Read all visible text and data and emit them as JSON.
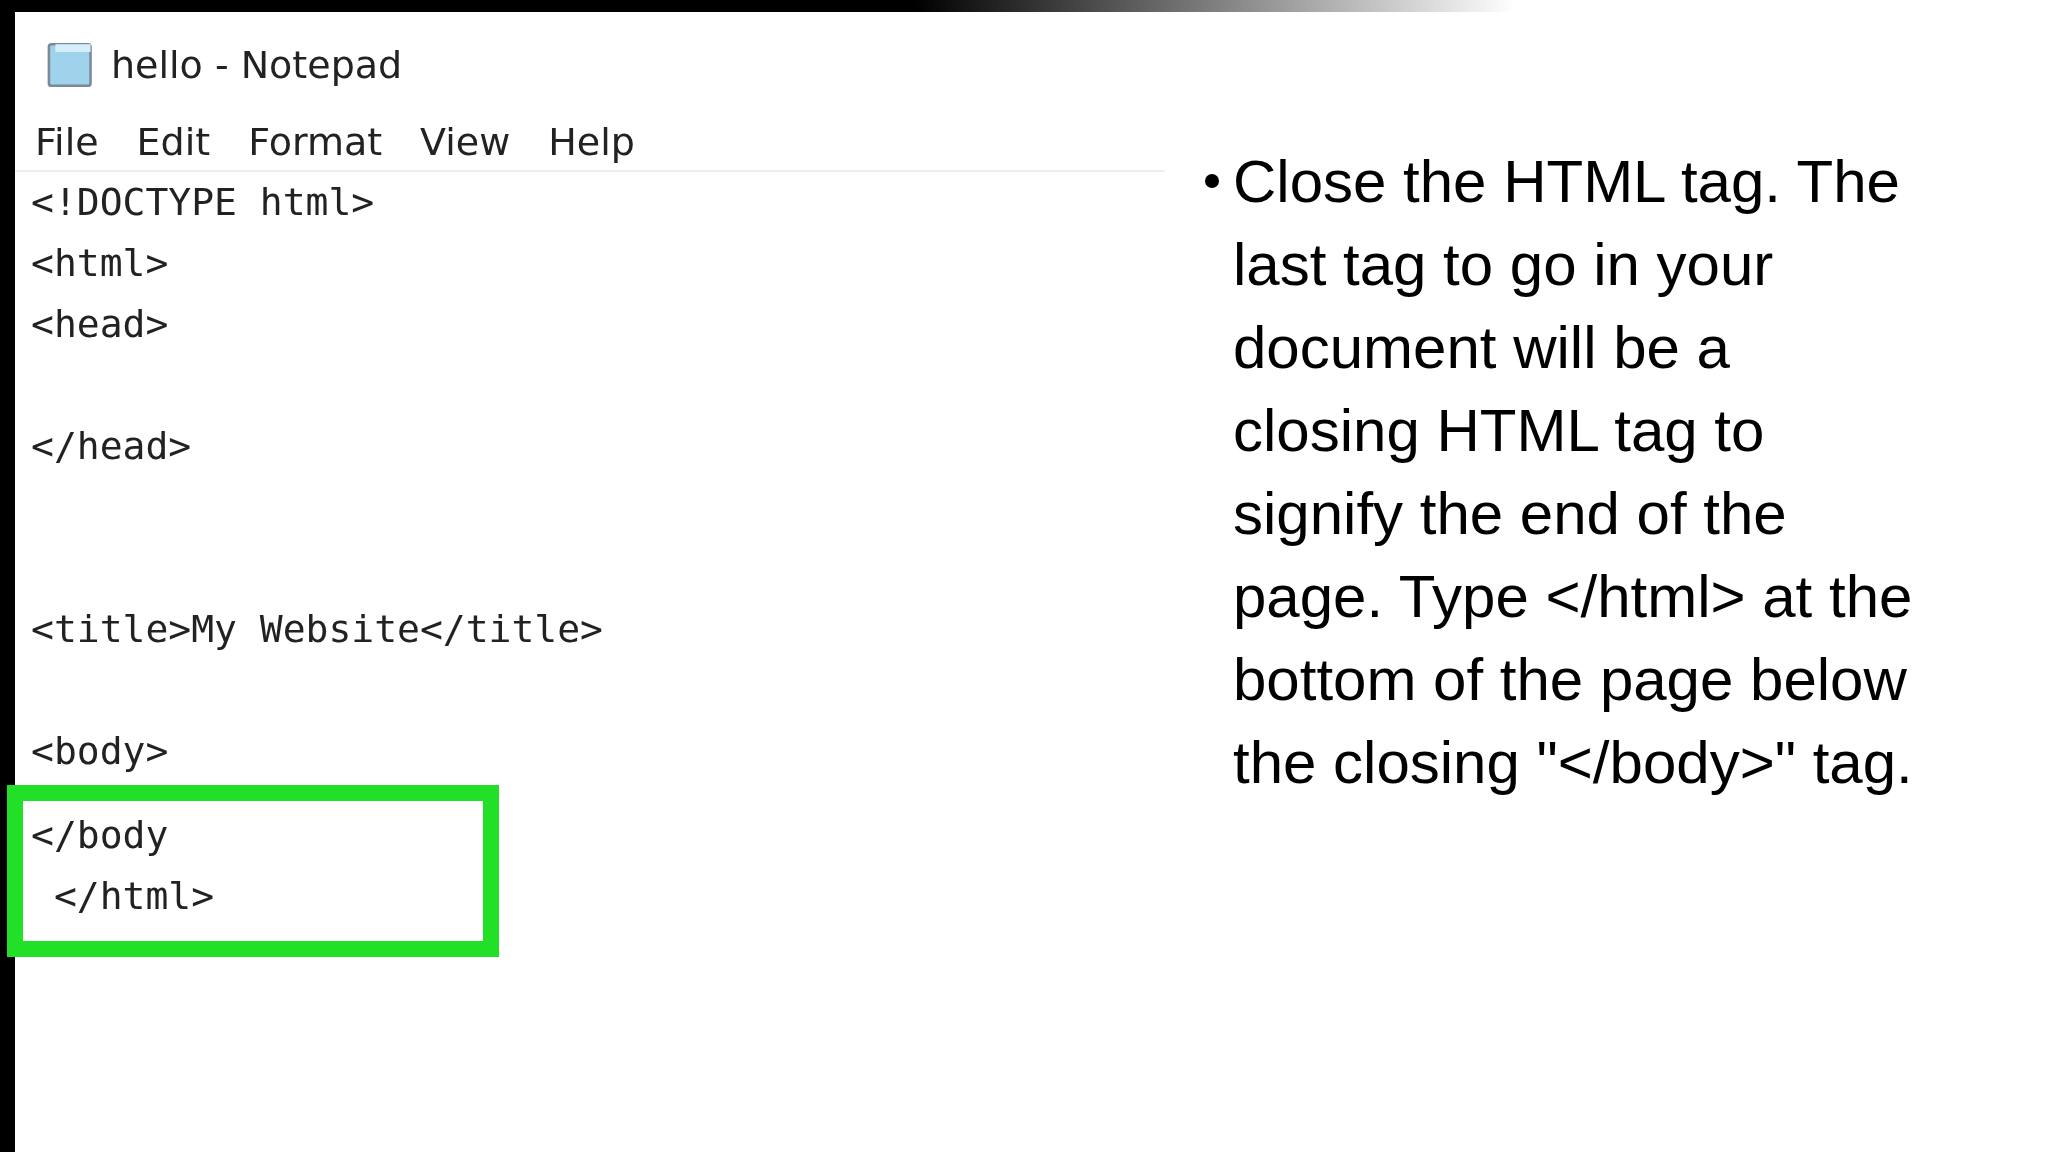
{
  "window": {
    "title": "hello - Notepad"
  },
  "menu": [
    "File",
    "Edit",
    "Format",
    "View",
    "Help"
  ],
  "editor": {
    "lines": [
      {
        "kind": "code",
        "text": "<!DOCTYPE html>"
      },
      {
        "kind": "code",
        "text": "<html>"
      },
      {
        "kind": "code",
        "text": "<head>"
      },
      {
        "kind": "blank"
      },
      {
        "kind": "code",
        "text": "</head>"
      },
      {
        "kind": "blank"
      },
      {
        "kind": "blank"
      },
      {
        "kind": "code",
        "text": "<title>My Website</title>"
      },
      {
        "kind": "blank"
      },
      {
        "kind": "code",
        "text": "<body>"
      },
      {
        "kind": "blank"
      }
    ],
    "highlighted_lines": [
      "</body",
      " </html>"
    ]
  },
  "bullets": [
    "Close the HTML tag. The last tag to go in your document will be a closing HTML tag to signify the end of the page. Type </html> at the bottom of the page below the closing \"</body>\" tag."
  ]
}
